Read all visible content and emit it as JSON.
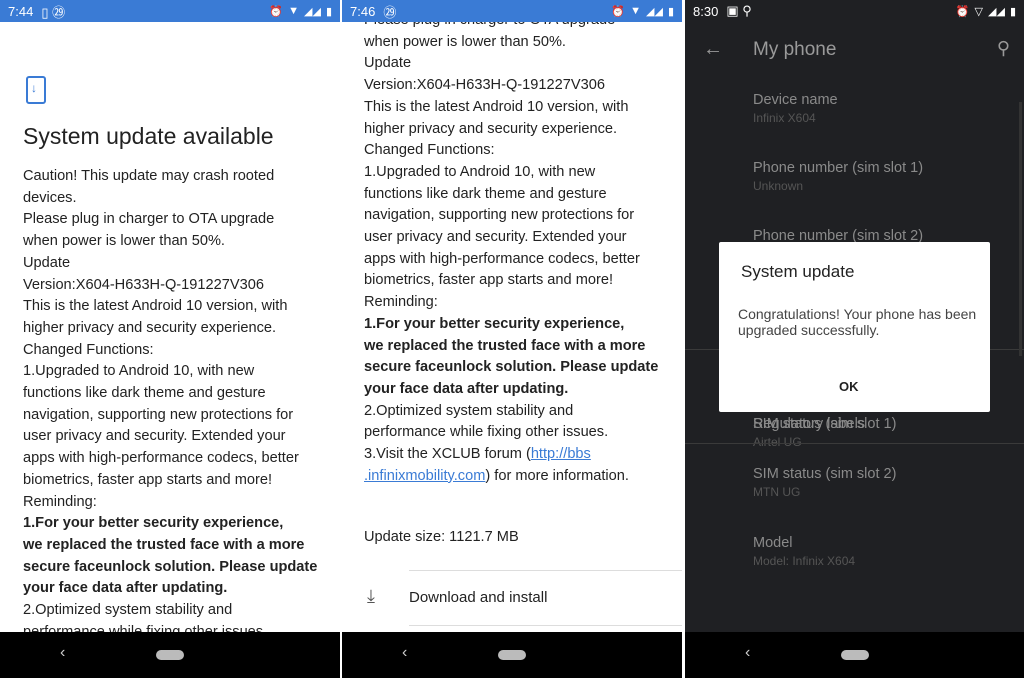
{
  "panels": [
    {
      "time": "7:44",
      "title": "System update available",
      "lines": [
        {
          "t": "Caution! This update may crash rooted"
        },
        {
          "t": "devices."
        },
        {
          "t": "Please plug in charger to OTA upgrade"
        },
        {
          "t": "when power is lower than 50%."
        },
        {
          "t": "Update"
        },
        {
          "t": "Version:X604-H633H-Q-191227V306"
        },
        {
          "t": "This is the latest Android 10 version, with"
        },
        {
          "t": "higher privacy and security experience."
        },
        {
          "t": "Changed Functions:"
        },
        {
          "t": "1.Upgraded to Android 10, with new"
        },
        {
          "t": "functions like dark theme and gesture"
        },
        {
          "t": "navigation, supporting new protections for"
        },
        {
          "t": "user privacy and security. Extended your"
        },
        {
          "t": "apps with high-performance codecs, better"
        },
        {
          "t": "biometrics, faster app starts and more!"
        },
        {
          "t": "Reminding:"
        },
        {
          "t": "1.For your better security experience,",
          "b": true
        },
        {
          "t": "we replaced the trusted face with a more",
          "b": true
        },
        {
          "t": "secure faceunlock solution. Please update",
          "b": true
        },
        {
          "t": "your face data after updating.",
          "b": true
        },
        {
          "t": "2.Optimized system stability and"
        },
        {
          "t": "performance while fixing other issues."
        }
      ]
    },
    {
      "time": "7:46",
      "lines": [
        {
          "t": "Please plug in charger to OTA upgrade"
        },
        {
          "t": "when power is lower than 50%."
        },
        {
          "t": "Update"
        },
        {
          "t": "Version:X604-H633H-Q-191227V306"
        },
        {
          "t": "This is the latest Android 10 version, with"
        },
        {
          "t": "higher privacy and security experience."
        },
        {
          "t": "Changed Functions:"
        },
        {
          "t": "1.Upgraded to Android 10, with new"
        },
        {
          "t": "functions like dark theme and gesture"
        },
        {
          "t": "navigation, supporting new protections for"
        },
        {
          "t": "user privacy and security. Extended your"
        },
        {
          "t": "apps with high-performance codecs, better"
        },
        {
          "t": "biometrics, faster app starts and more!"
        },
        {
          "t": "Reminding:"
        },
        {
          "t": "1.For your better security experience,",
          "b": true
        },
        {
          "t": "we replaced the trusted face with a more",
          "b": true
        },
        {
          "t": "secure faceunlock solution. Please update",
          "b": true
        },
        {
          "t": "your face data after updating.",
          "b": true
        },
        {
          "t": "2.Optimized system stability and"
        },
        {
          "t": "performance while fixing other issues."
        }
      ],
      "forum_prefix": "3.Visit the XCLUB forum (",
      "link1": "http://bbs",
      "link2": ".infinixmobility.com",
      "forum_suffix": ") for more information.",
      "update_size": "Update size: 1121.7 MB",
      "download_label": "Download and install"
    },
    {
      "time": "8:30",
      "title": "My phone",
      "settings": [
        {
          "title": "Device name",
          "sub": "Infinix X604"
        },
        {
          "title": "Phone number (sim slot 1)",
          "sub": "Unknown"
        },
        {
          "title": "Phone number (sim slot 2)",
          "sub": ""
        },
        {
          "title": "Regulatory labels",
          "sub": ""
        },
        {
          "title": "SIM status (sim slot 1)",
          "sub": "Airtel UG"
        },
        {
          "title": "SIM status (sim slot 2)",
          "sub": "MTN UG"
        },
        {
          "title": "Model",
          "sub": "Model: Infinix X604"
        }
      ],
      "dialog": {
        "title": "System update",
        "message": "Congratulations! Your phone has been upgraded successfully.",
        "ok": "OK"
      }
    }
  ],
  "colors": {
    "accent": "#3a7bd5",
    "dark_bg": "#1f2023"
  }
}
